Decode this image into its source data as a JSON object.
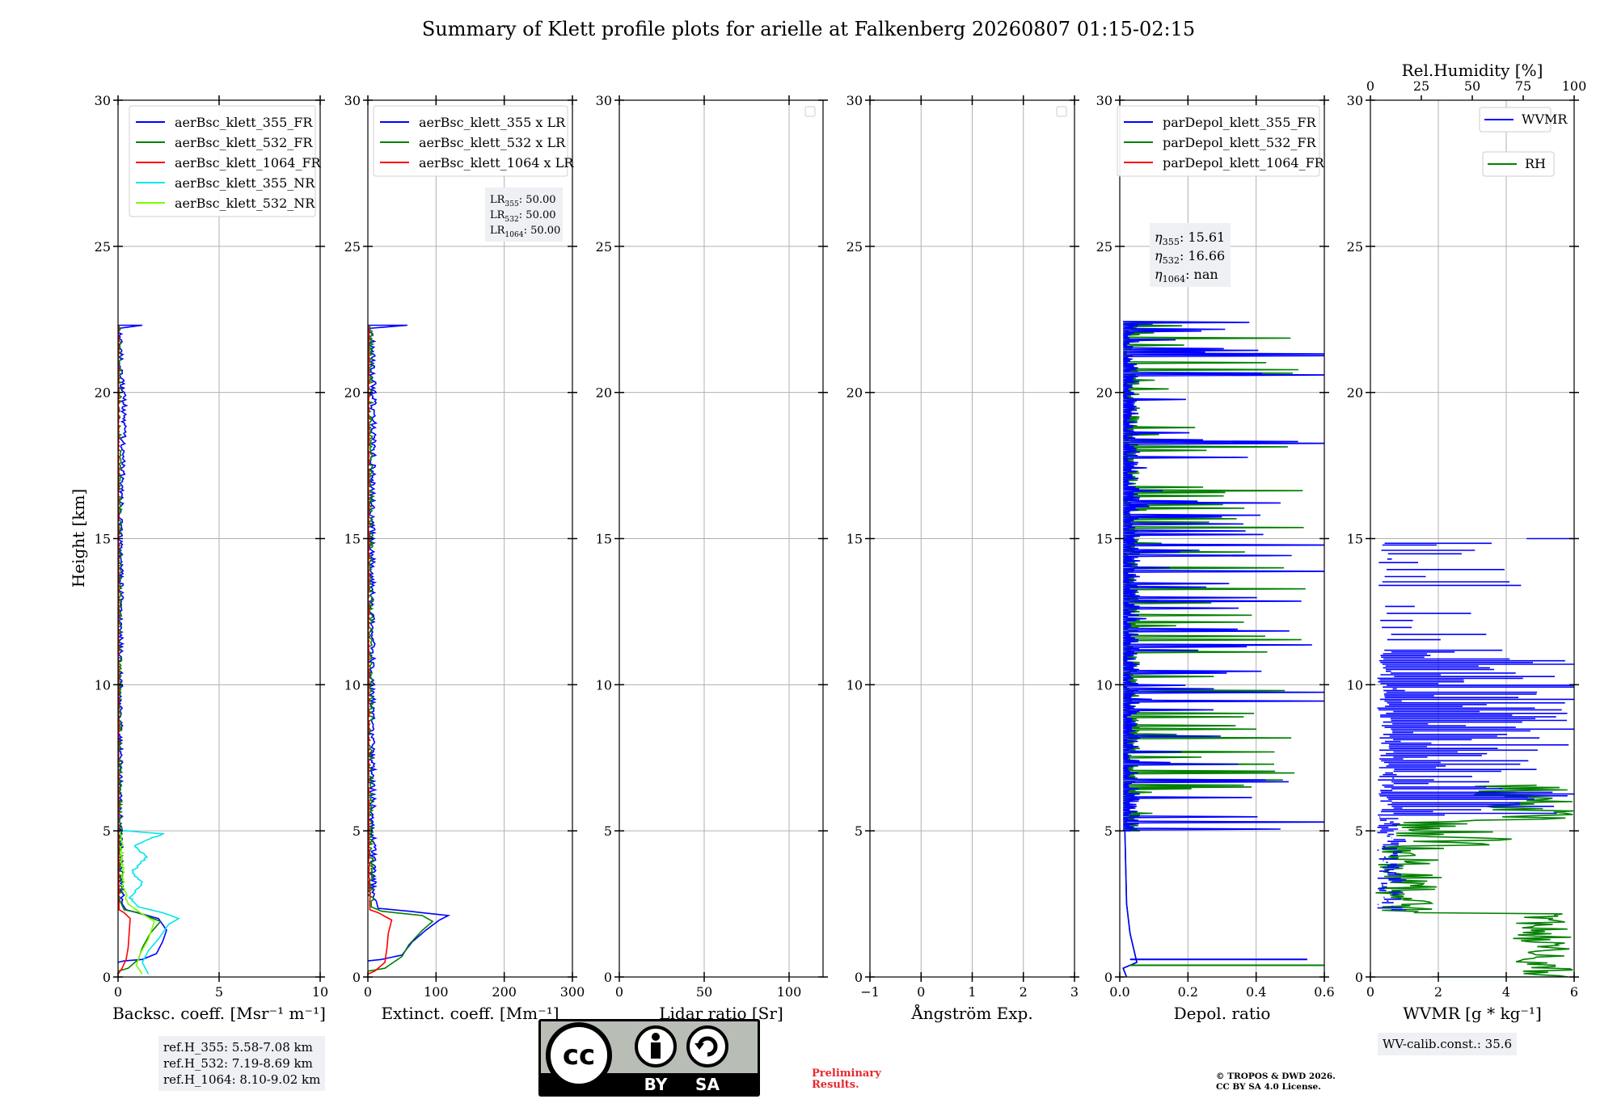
{
  "title": "Summary of Klett profile plots for arielle at Falkenberg 20260807 01:15-02:15",
  "ylabel": "Height [km]",
  "chart_data": [
    {
      "type": "line",
      "panel": "backscatter",
      "xlabel": "Backsc. coeff. [Msr⁻¹ m⁻¹]",
      "xlim": [
        0,
        10
      ],
      "xticks": [
        "0",
        "5",
        "10"
      ],
      "xtick_values": [
        0,
        5,
        10
      ],
      "ylim": [
        0,
        30
      ],
      "yticks": [
        "0",
        "5",
        "10",
        "15",
        "20",
        "25",
        "30"
      ],
      "grid": true,
      "legend_position": "upper-right",
      "series": [
        {
          "name": "aerBsc_klett_355_FR",
          "color": "#0000ff",
          "profile": [
            [
              0,
              0.5
            ],
            [
              0.3,
              0.55
            ],
            [
              1.2,
              0.6
            ],
            [
              1.9,
              0.8
            ],
            [
              2.2,
              1.2
            ],
            [
              2.4,
              1.6
            ],
            [
              2.0,
              2.0
            ],
            [
              1.2,
              2.15
            ],
            [
              0.4,
              2.3
            ],
            [
              0.2,
              2.5
            ],
            [
              0.15,
              3.5
            ],
            [
              0.12,
              4.5
            ],
            [
              0.1,
              6
            ],
            [
              0.1,
              9
            ],
            [
              0.12,
              12
            ],
            [
              0.15,
              13
            ],
            [
              0.1,
              15
            ],
            [
              0.2,
              17
            ],
            [
              0.3,
              19.5
            ],
            [
              0.15,
              21
            ],
            [
              0.1,
              22.2
            ],
            [
              1.2,
              22.3
            ],
            [
              0,
              22.3
            ]
          ]
        },
        {
          "name": "aerBsc_klett_532_FR",
          "color": "#008000",
          "profile": [
            [
              0,
              0.2
            ],
            [
              0.5,
              0.3
            ],
            [
              1.0,
              0.6
            ],
            [
              1.2,
              1.0
            ],
            [
              1.6,
              1.5
            ],
            [
              2.1,
              1.9
            ],
            [
              1.0,
              2.2
            ],
            [
              0.3,
              2.3
            ],
            [
              0.1,
              2.6
            ],
            [
              0.08,
              5
            ],
            [
              0.05,
              10
            ],
            [
              0.05,
              15
            ],
            [
              0.05,
              20
            ],
            [
              0.05,
              22.3
            ]
          ]
        },
        {
          "name": "aerBsc_klett_1064_FR",
          "color": "#ff0000",
          "profile": [
            [
              0,
              0.1
            ],
            [
              0.2,
              0.3
            ],
            [
              0.4,
              0.6
            ],
            [
              0.5,
              1.0
            ],
            [
              0.55,
              1.5
            ],
            [
              0.6,
              2.0
            ],
            [
              0.3,
              2.2
            ],
            [
              0.05,
              2.3
            ],
            [
              0.02,
              5
            ],
            [
              0.02,
              12
            ],
            [
              0.02,
              22.3
            ]
          ]
        },
        {
          "name": "aerBsc_klett_355_NR",
          "color": "#00e5ee",
          "profile": [
            [
              1.5,
              0.1
            ],
            [
              1.2,
              0.5
            ],
            [
              1.5,
              0.9
            ],
            [
              2.0,
              1.3
            ],
            [
              2.5,
              1.8
            ],
            [
              3.0,
              2.0
            ],
            [
              2.2,
              2.2
            ],
            [
              1.0,
              2.4
            ],
            [
              0.6,
              2.7
            ],
            [
              1.2,
              3.2
            ],
            [
              0.7,
              3.6
            ],
            [
              1.4,
              4.1
            ],
            [
              0.8,
              4.5
            ],
            [
              2.2,
              4.9
            ],
            [
              0.4,
              5.0
            ],
            [
              0,
              5.0
            ]
          ]
        },
        {
          "name": "aerBsc_klett_532_NR",
          "color": "#7cfc00",
          "profile": [
            [
              1.2,
              0.1
            ],
            [
              0.9,
              0.4
            ],
            [
              1.1,
              0.8
            ],
            [
              1.5,
              1.3
            ],
            [
              1.8,
              1.9
            ],
            [
              1.1,
              2.2
            ],
            [
              0.5,
              2.5
            ],
            [
              0.3,
              3
            ],
            [
              0.2,
              4
            ],
            [
              0.15,
              5
            ],
            [
              0,
              5
            ]
          ]
        }
      ]
    },
    {
      "type": "line",
      "panel": "extinction",
      "xlabel": "Extinct. coeff. [Mm⁻¹]",
      "xlim": [
        0,
        300
      ],
      "xticks": [
        "0",
        "100",
        "200",
        "300"
      ],
      "xtick_values": [
        0,
        100,
        200,
        300
      ],
      "ylim": [
        0,
        30
      ],
      "grid": true,
      "legend_position": "upper-right",
      "annotation": [
        [
          "LR",
          "355",
          ": 50.00"
        ],
        [
          "LR",
          "532",
          ": 50.00"
        ],
        [
          "LR",
          "1064",
          ": 50.00"
        ]
      ],
      "series": [
        {
          "name": "aerBsc_klett_355 x LR",
          "color": "#0000ff",
          "profile": [
            [
              0,
              0.55
            ],
            [
              20,
              0.6
            ],
            [
              50,
              0.75
            ],
            [
              65,
              1.2
            ],
            [
              85,
              1.6
            ],
            [
              105,
              1.95
            ],
            [
              118,
              2.1
            ],
            [
              60,
              2.25
            ],
            [
              15,
              2.35
            ],
            [
              8,
              3
            ],
            [
              7,
              5
            ],
            [
              6,
              10
            ],
            [
              6,
              15
            ],
            [
              8,
              20
            ],
            [
              5,
              22.2
            ],
            [
              58,
              22.3
            ],
            [
              0,
              22.3
            ]
          ]
        },
        {
          "name": "aerBsc_klett_532 x LR",
          "color": "#008000",
          "profile": [
            [
              0,
              0.2
            ],
            [
              25,
              0.3
            ],
            [
              50,
              0.7
            ],
            [
              60,
              1.1
            ],
            [
              80,
              1.6
            ],
            [
              95,
              1.9
            ],
            [
              80,
              2.1
            ],
            [
              20,
              2.25
            ],
            [
              5,
              2.4
            ],
            [
              3,
              5
            ],
            [
              3,
              12
            ],
            [
              3,
              22.3
            ]
          ]
        },
        {
          "name": "aerBsc_klett_1064 x LR",
          "color": "#ff0000",
          "profile": [
            [
              0,
              0.1
            ],
            [
              10,
              0.2
            ],
            [
              25,
              0.5
            ],
            [
              28,
              1.0
            ],
            [
              30,
              1.5
            ],
            [
              35,
              1.95
            ],
            [
              15,
              2.2
            ],
            [
              3,
              2.3
            ],
            [
              1,
              5
            ],
            [
              1,
              15
            ],
            [
              1,
              22.3
            ]
          ]
        }
      ]
    },
    {
      "type": "line",
      "panel": "lidar_ratio",
      "xlabel": "Lidar ratio [Sr]",
      "xlim": [
        0,
        120
      ],
      "xticks": [
        "0",
        "50",
        "100"
      ],
      "xtick_values": [
        0,
        50,
        100
      ],
      "ylim": [
        0,
        30
      ],
      "grid": true,
      "legend_position": "upper-right",
      "series": []
    },
    {
      "type": "line",
      "panel": "angstrom",
      "xlabel": "Ångström Exp.",
      "xlim": [
        -1,
        3
      ],
      "xticks": [
        "−1",
        "0",
        "1",
        "2",
        "3"
      ],
      "xtick_values": [
        -1,
        0,
        1,
        2,
        3
      ],
      "ylim": [
        0,
        30
      ],
      "grid": true,
      "legend_position": "upper-right",
      "series": []
    },
    {
      "type": "line",
      "panel": "depolarization",
      "xlabel": "Depol. ratio",
      "xlim": [
        0,
        0.6
      ],
      "xticks": [
        "0.0",
        "0.2",
        "0.4",
        "0.6"
      ],
      "xtick_values": [
        0,
        0.2,
        0.4,
        0.6
      ],
      "ylim": [
        0,
        30
      ],
      "grid": true,
      "legend_position": "upper-right",
      "annotation": [
        [
          "η",
          "355",
          ": 15.61"
        ],
        [
          "η",
          "532",
          ": 16.66"
        ],
        [
          "η",
          "1064",
          ": nan"
        ]
      ],
      "series": [
        {
          "name": "parDepol_klett_355_FR",
          "color": "#0000ff"
        },
        {
          "name": "parDepol_klett_532_FR",
          "color": "#008000"
        },
        {
          "name": "parDepol_klett_1064_FR",
          "color": "#ff0000"
        }
      ]
    },
    {
      "type": "line",
      "panel": "wvmr",
      "xlabel": "WVMR [g * kg⁻¹]",
      "xlim": [
        0,
        6
      ],
      "xticks": [
        "0",
        "2",
        "4",
        "6"
      ],
      "xtick_values": [
        0,
        2,
        4,
        6
      ],
      "top_xlabel": "Rel.Humidity [%]",
      "top_xlim": [
        0,
        100
      ],
      "top_xticks": [
        "0",
        "25",
        "50",
        "75",
        "100"
      ],
      "top_xtick_values": [
        0,
        25,
        50,
        75,
        100
      ],
      "ylim": [
        0,
        30
      ],
      "grid": true,
      "legend_position": "upper-right",
      "series": [
        {
          "name": "WVMR",
          "color": "#0000ff"
        },
        {
          "name": "RH",
          "color": "#008000"
        }
      ]
    }
  ],
  "y_ticks_common": [
    "0",
    "5",
    "10",
    "15",
    "20",
    "25",
    "30"
  ],
  "ref_heights": [
    "ref.H_355: 5.58-7.08 km",
    "ref.H_532: 7.19-8.69 km",
    "ref.H_1064: 8.10-9.02 km"
  ],
  "wv_calib": "WV-calib.const.: 35.6",
  "cc_badge": {
    "cc": "cc",
    "by": "BY",
    "sa": "SA"
  },
  "preliminary": "Preliminary Results.",
  "copyright": [
    "© TROPOS & DWD 2026.",
    "CC BY SA 4.0 License."
  ]
}
